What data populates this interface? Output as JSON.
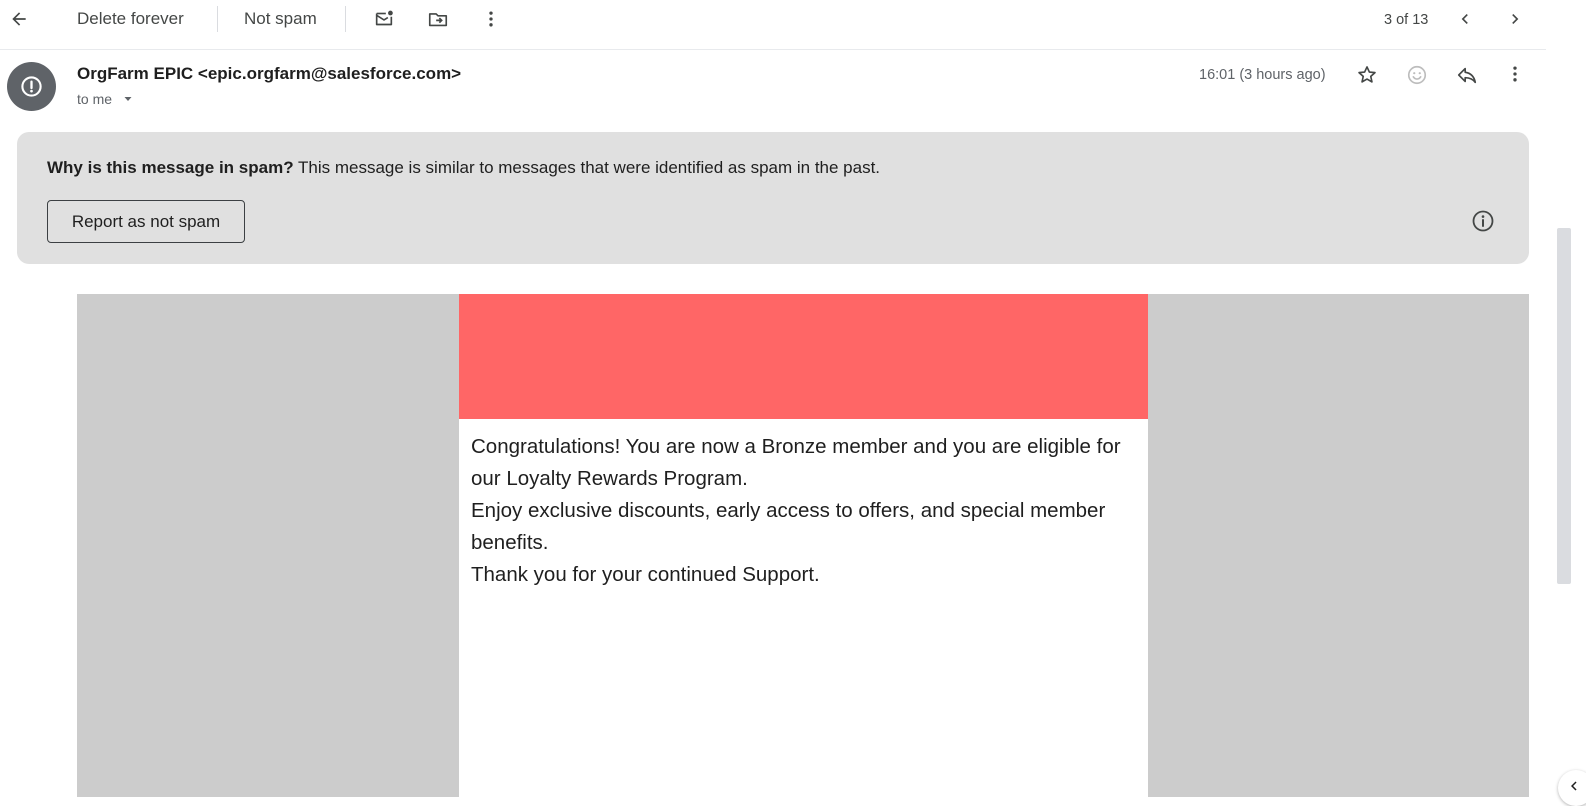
{
  "toolbar": {
    "delete_forever": "Delete forever",
    "not_spam": "Not spam",
    "pagination": "3 of 13",
    "icons": [
      "back-arrow-icon",
      "mark-unread-icon",
      "move-to-icon",
      "more-vert-icon",
      "chevron-left-icon",
      "chevron-right-icon"
    ]
  },
  "message": {
    "sender": "OrgFarm EPIC <epic.orgfarm@salesforce.com>",
    "recipient": "to me",
    "timestamp": "16:01 (3 hours ago)",
    "avatar_icon": "alert-circle-icon",
    "action_icons": [
      "star-icon",
      "emoji-icon",
      "reply-icon",
      "more-vert-icon"
    ]
  },
  "spam_banner": {
    "question": "Why is this message in spam?",
    "explanation": " This message is similar to messages that were identified as spam in the past.",
    "report_button": "Report as not spam",
    "info_icon": "info-icon"
  },
  "email_body": {
    "hero_color": "#ff6666",
    "line1": "Congratulations! You are now a Bronze member and you are eligible for our Loyalty Rewards Program.",
    "line2": "Enjoy exclusive discounts, early access to offers, and special member benefits.",
    "line3": "Thank you for your continued Support."
  },
  "colors": {
    "banner_bg": "#e0e0e0",
    "canvas_bg": "#cccccc",
    "avatar_bg": "#5f6368"
  }
}
